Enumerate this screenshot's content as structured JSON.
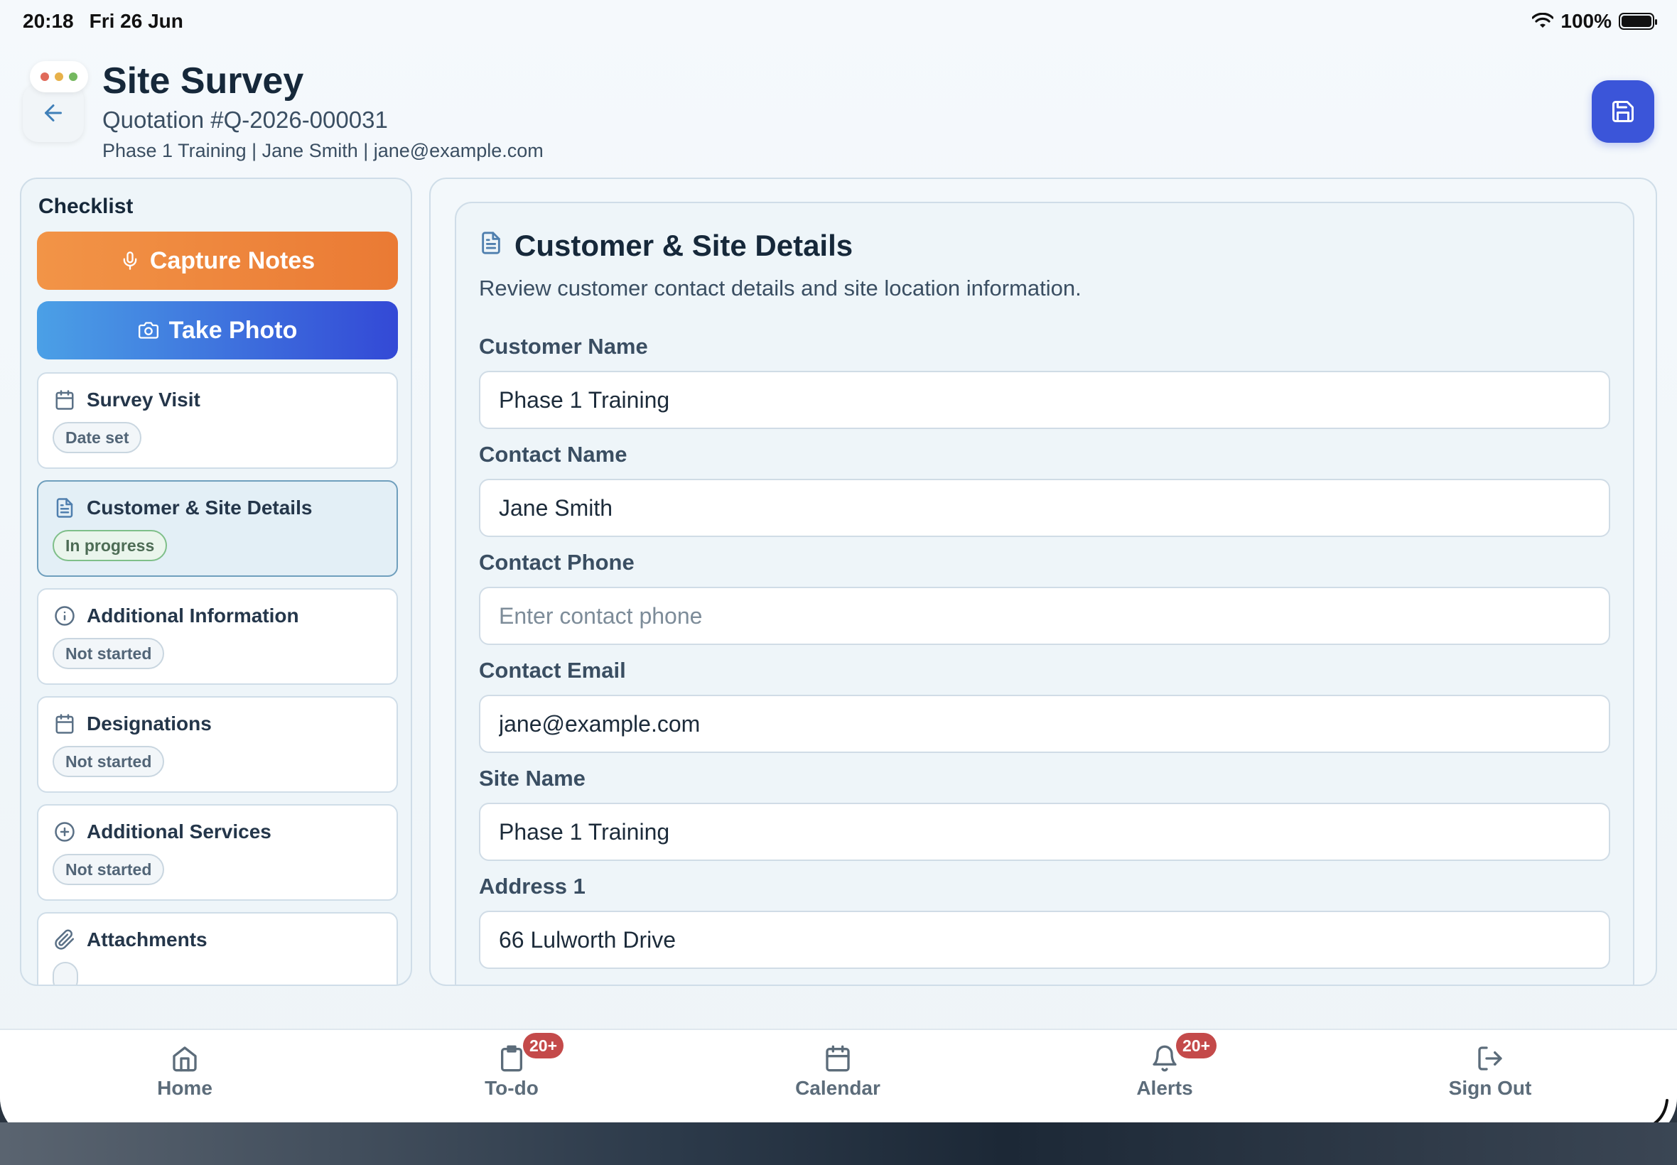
{
  "status_bar": {
    "time": "20:18",
    "date": "Fri 26 Jun",
    "battery": "100%"
  },
  "header": {
    "title": "Site Survey",
    "quotation": "Quotation #Q-2026-000031",
    "meta": "Phase 1 Training | Jane Smith | jane@example.com"
  },
  "sidebar": {
    "title": "Checklist",
    "capture_notes": "Capture Notes",
    "take_photo": "Take Photo",
    "items": [
      {
        "label": "Survey Visit",
        "status": "Date set",
        "icon": "calendar-icon"
      },
      {
        "label": "Customer & Site Details",
        "status": "In progress",
        "icon": "document-icon"
      },
      {
        "label": "Additional Information",
        "status": "Not started",
        "icon": "info-icon"
      },
      {
        "label": "Designations",
        "status": "Not started",
        "icon": "calendar-icon"
      },
      {
        "label": "Additional Services",
        "status": "Not started",
        "icon": "plus-circle-icon"
      },
      {
        "label": "Attachments",
        "status": "",
        "icon": "paperclip-icon"
      }
    ]
  },
  "main": {
    "title": "Customer & Site Details",
    "description": "Review customer contact details and site location information.",
    "fields": {
      "customer_name": {
        "label": "Customer Name",
        "value": "Phase 1 Training",
        "placeholder": ""
      },
      "contact_name": {
        "label": "Contact Name",
        "value": "Jane Smith",
        "placeholder": ""
      },
      "contact_phone": {
        "label": "Contact Phone",
        "value": "",
        "placeholder": "Enter contact phone"
      },
      "contact_email": {
        "label": "Contact Email",
        "value": "jane@example.com",
        "placeholder": ""
      },
      "site_name": {
        "label": "Site Name",
        "value": "Phase 1 Training",
        "placeholder": ""
      },
      "address1": {
        "label": "Address 1",
        "value": "66 Lulworth Drive",
        "placeholder": ""
      }
    }
  },
  "tabbar": {
    "home": "Home",
    "todo": "To-do",
    "todo_badge": "20+",
    "calendar": "Calendar",
    "alerts": "Alerts",
    "alerts_badge": "20+",
    "signout": "Sign Out"
  },
  "colors": {
    "primary": "#3b55d9",
    "orange": "#ea7a34",
    "badge_red": "#c44a4a",
    "progress_green": "#7fbf89"
  }
}
